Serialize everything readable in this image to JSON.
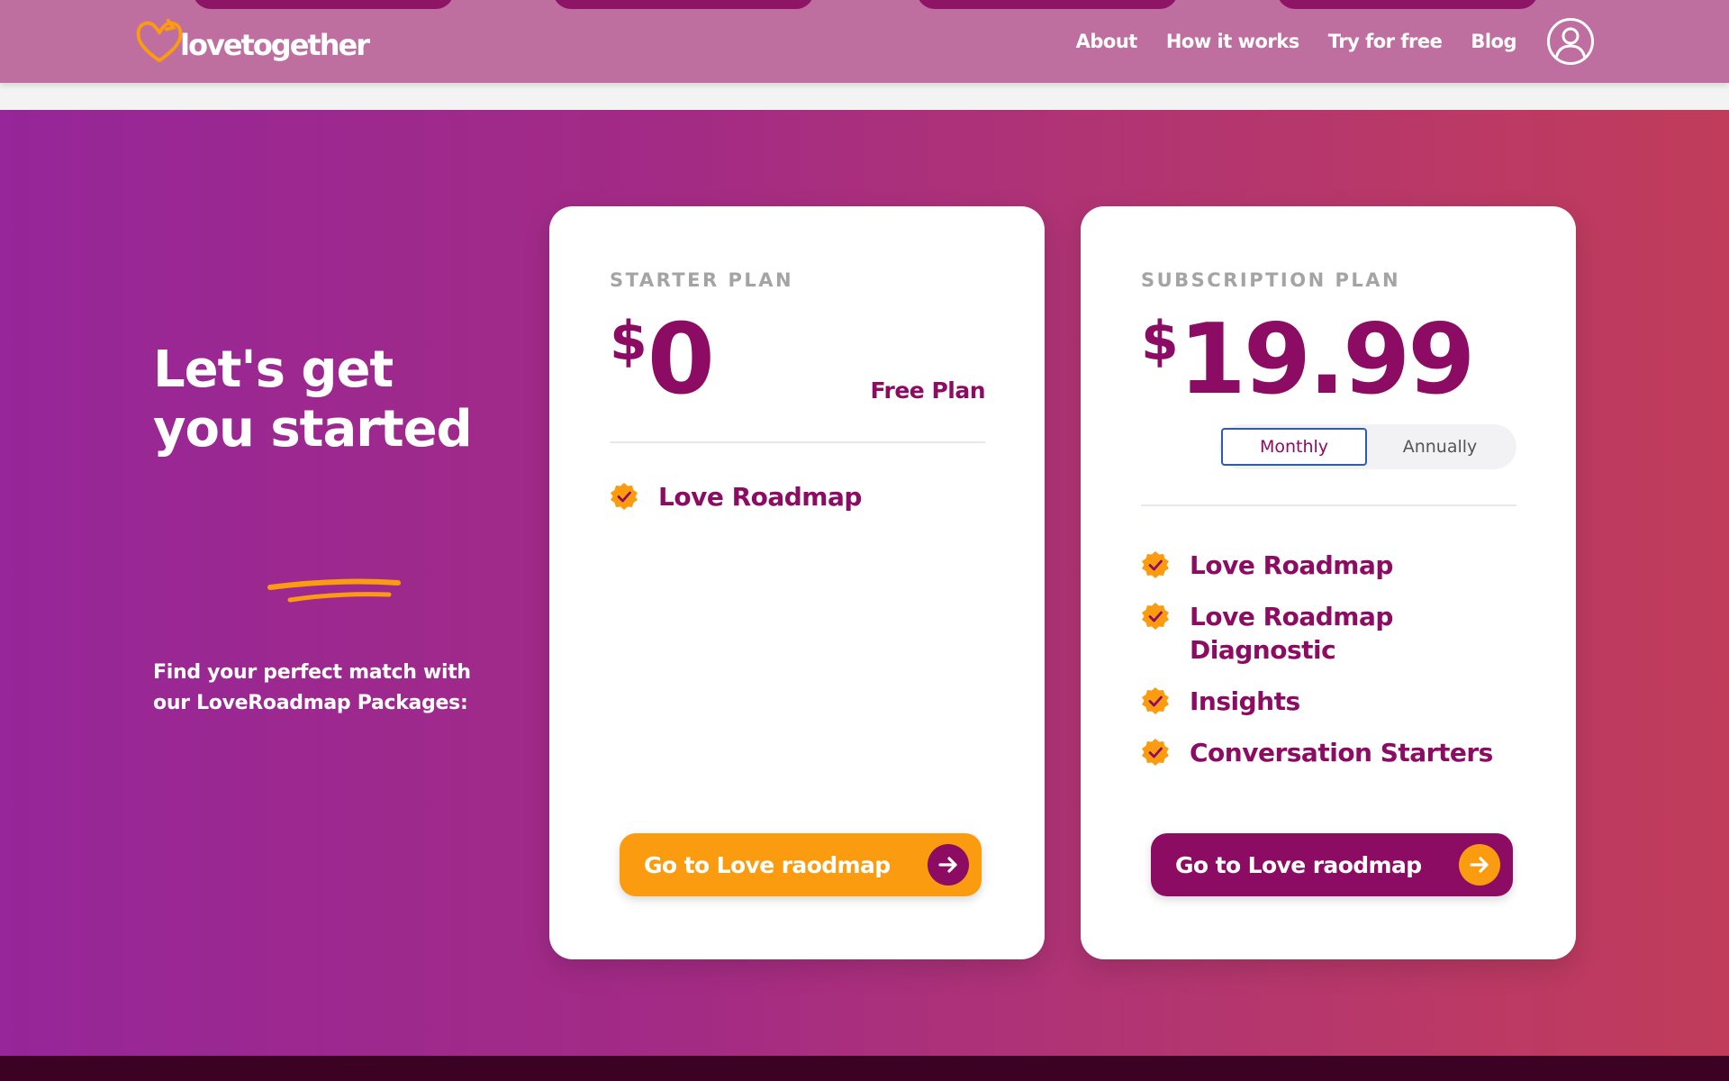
{
  "header": {
    "logo_text": "lovetogether",
    "nav": [
      "About",
      "How it works",
      "Try for free",
      "Blog"
    ]
  },
  "hero": {
    "headline_line1": "Let's get",
    "headline_line2": "you started",
    "subtext": "Find your perfect match with our LoveRoadmap Packages:"
  },
  "starter": {
    "plan_name": "STARTER PLAN",
    "currency": "$",
    "price": "0",
    "price_label": "Free Plan",
    "features": [
      "Love Roadmap"
    ],
    "cta": "Go to Love raodmap"
  },
  "subscription": {
    "plan_name": "SUBSCRIPTION PLAN",
    "currency": "$",
    "price": "19.99",
    "billing_options": [
      "Monthly",
      "Annually"
    ],
    "billing_selected": "Monthly",
    "features": [
      "Love Roadmap",
      "Love Roadmap Diagnostic",
      "Insights",
      "Conversation Starters"
    ],
    "cta": "Go to Love raodmap"
  },
  "colors": {
    "brand_purple": "#8c0b63",
    "brand_orange": "#fb9b0f",
    "header_bg": "#bf6f9f"
  }
}
